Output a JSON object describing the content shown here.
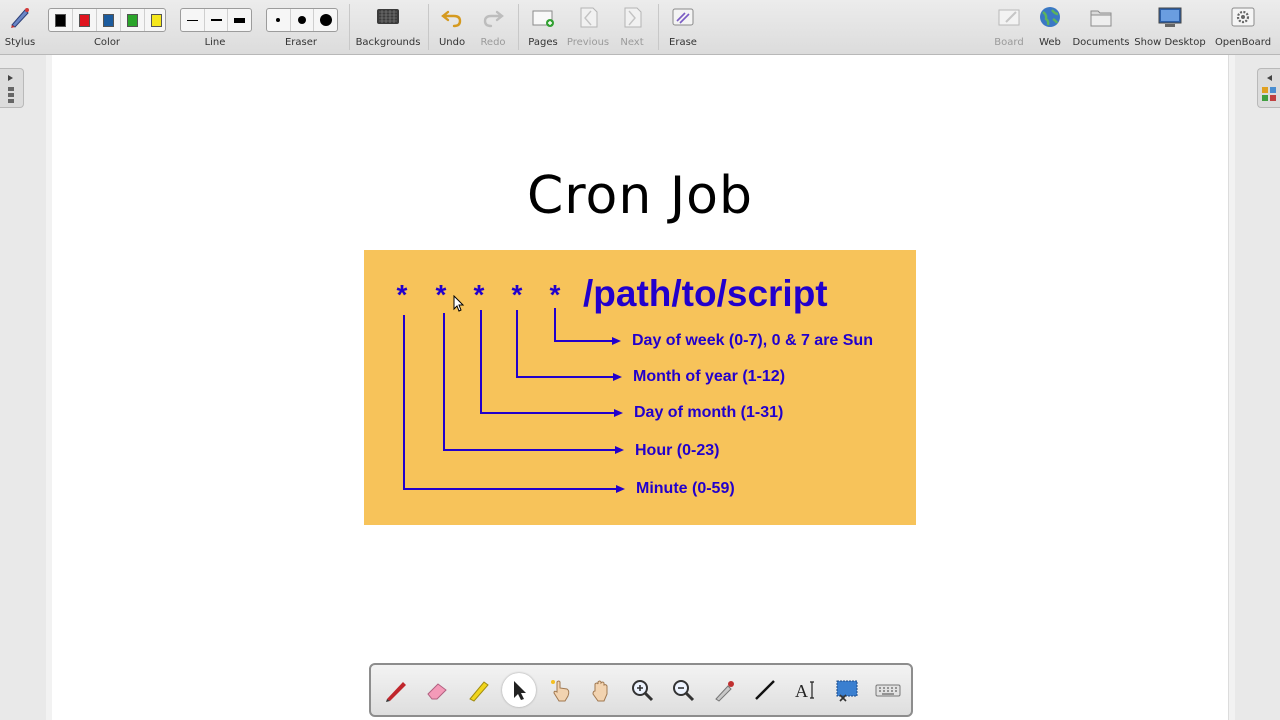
{
  "toolbar": {
    "stylus": "Stylus",
    "color": "Color",
    "line": "Line",
    "eraser": "Eraser",
    "backgrounds": "Backgrounds",
    "undo": "Undo",
    "redo": "Redo",
    "pages": "Pages",
    "previous": "Previous",
    "next": "Next",
    "erase": "Erase",
    "board": "Board",
    "web": "Web",
    "documents": "Documents",
    "show_desktop": "Show Desktop",
    "openboard": "OpenBoard",
    "colors": [
      "#000000",
      "#e0141e",
      "#1d5c9e",
      "#2ba52b",
      "#f5e71c"
    ]
  },
  "board": {
    "title": "Cron Job",
    "command": "/path/to/script",
    "stars": [
      "*",
      "*",
      "*",
      "*",
      "*"
    ],
    "fields": [
      "Day of week (0-7), 0 & 7 are Sun",
      "Month of year (1-12)",
      "Day of month (1-31)",
      "Hour (0-23)",
      "Minute (0-59)"
    ],
    "accent_color": "#2200cc",
    "panel_color": "#f7c35a"
  },
  "palette": {
    "tools": [
      "pen-icon",
      "eraser-icon",
      "highlighter-icon",
      "selector-icon",
      "laser-pointer-icon",
      "hand-icon",
      "zoom-in-icon",
      "zoom-out-icon",
      "capture-pen-icon",
      "line-icon",
      "text-icon",
      "screen-capture-icon",
      "keyboard-icon"
    ],
    "active_tool": "selector-icon"
  }
}
